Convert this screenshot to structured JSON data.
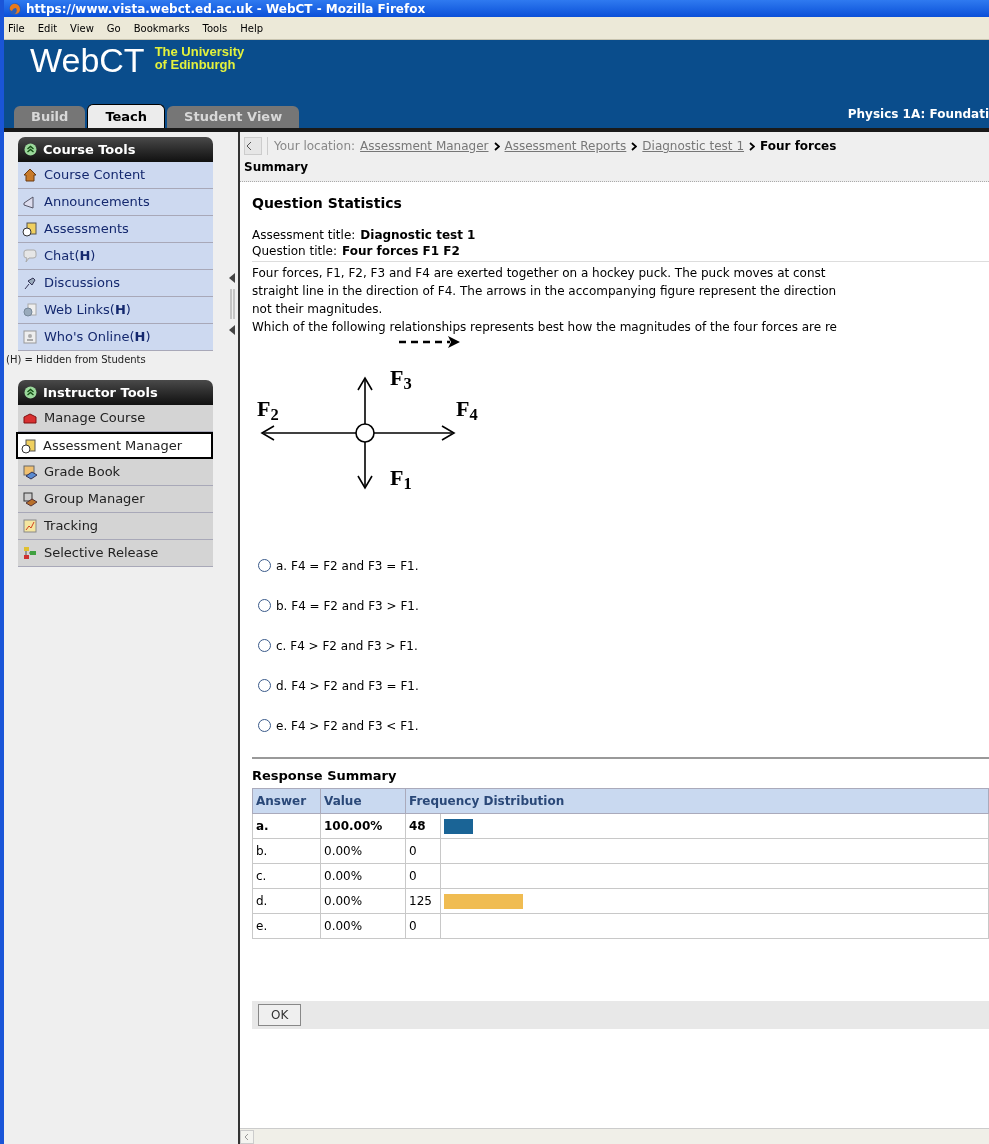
{
  "window": {
    "title": "https://www.vista.webct.ed.ac.uk - WebCT - Mozilla Firefox"
  },
  "menu": [
    "File",
    "Edit",
    "View",
    "Go",
    "Bookmarks",
    "Tools",
    "Help"
  ],
  "header": {
    "logo": "WebCT",
    "institution": [
      "The University",
      "of Edinburgh"
    ],
    "course_title": "Physics 1A: Foundati"
  },
  "tabs": [
    {
      "label": "Build",
      "selected": false
    },
    {
      "label": "Teach",
      "selected": true
    },
    {
      "label": "Student View",
      "selected": false
    }
  ],
  "sidebar": {
    "sections": [
      {
        "title": "Course Tools",
        "expanded": true,
        "footnote": "(H) = Hidden from Students",
        "items": [
          {
            "label": "Course Content",
            "selected": false
          },
          {
            "label": "Announcements",
            "selected": false
          },
          {
            "label": "Assessments",
            "selected": false
          },
          {
            "label": "Chat(**H**)",
            "selected": false
          },
          {
            "label": "Discussions",
            "selected": false
          },
          {
            "label": "Web Links(**H**)",
            "selected": false
          },
          {
            "label": "Who's Online(**H**)",
            "selected": false
          }
        ]
      },
      {
        "title": "Instructor Tools",
        "expanded": true,
        "items": [
          {
            "label": "Manage Course",
            "selected": false
          },
          {
            "label": "Assessment Manager",
            "selected": true
          },
          {
            "label": "Grade Book",
            "selected": false
          },
          {
            "label": "Group Manager",
            "selected": false
          },
          {
            "label": "Tracking",
            "selected": false
          },
          {
            "label": "Selective Release",
            "selected": false
          }
        ]
      }
    ]
  },
  "breadcrumb": {
    "prefix": "Your location:",
    "links": [
      "Assessment Manager",
      "Assessment Reports",
      "Diagnostic test 1"
    ],
    "current": "Four forces"
  },
  "page_title": "Summary",
  "question": {
    "heading": "Question Statistics",
    "assessment_label": "Assessment title:",
    "assessment_title": "Diagnostic test 1",
    "question_label": "Question title:",
    "question_title": "Four forces F1 F2",
    "text_lines": [
      "Four forces, F1, F2, F3 and F4 are exerted together on a hockey puck. The puck moves at const",
      "straight line in the direction of F4. The arrows in the accompanying figure represent the direction",
      "not their magnitudes.",
      "Which of the following relationships represents best how the magnitudes of the four forces are re"
    ],
    "figure_labels": [
      "F$_{1}$",
      "F$_{2}$",
      "F$_{3}$",
      "F$_{4}$"
    ],
    "options": [
      {
        "label": "a. F4 = F2 and F3 = F1.",
        "selected": false
      },
      {
        "label": "b. F4 = F2 and F3 > F1.",
        "selected": false
      },
      {
        "label": "c. F4 > F2 and F3 > F1.",
        "selected": false
      },
      {
        "label": "d. F4 > F2 and F3 = F1.",
        "selected": false
      },
      {
        "label": "e. F4 > F2 and F3 < F1.",
        "selected": false
      }
    ]
  },
  "response_summary": {
    "title": "Response Summary",
    "columns": [
      "Answer",
      "Value",
      "Frequency Distribution"
    ],
    "rows": [
      {
        "answer": "a.",
        "value": "100.00%",
        "count": "48",
        "correct": true,
        "level": 0.053,
        "color": "#1a6496"
      },
      {
        "answer": "b.",
        "value": "0.00%",
        "count": "0",
        "correct": false,
        "level": 0
      },
      {
        "answer": "c.",
        "value": "0.00%",
        "count": "0",
        "correct": false,
        "level": 0
      },
      {
        "answer": "d.",
        "value": "0.00%",
        "count": "125",
        "correct": false,
        "level": 0.146,
        "color": "#f0bc52"
      },
      {
        "answer": "e.",
        "value": "0.00%",
        "count": "0",
        "correct": false,
        "level": 0
      }
    ]
  },
  "ok_button": "OK"
}
